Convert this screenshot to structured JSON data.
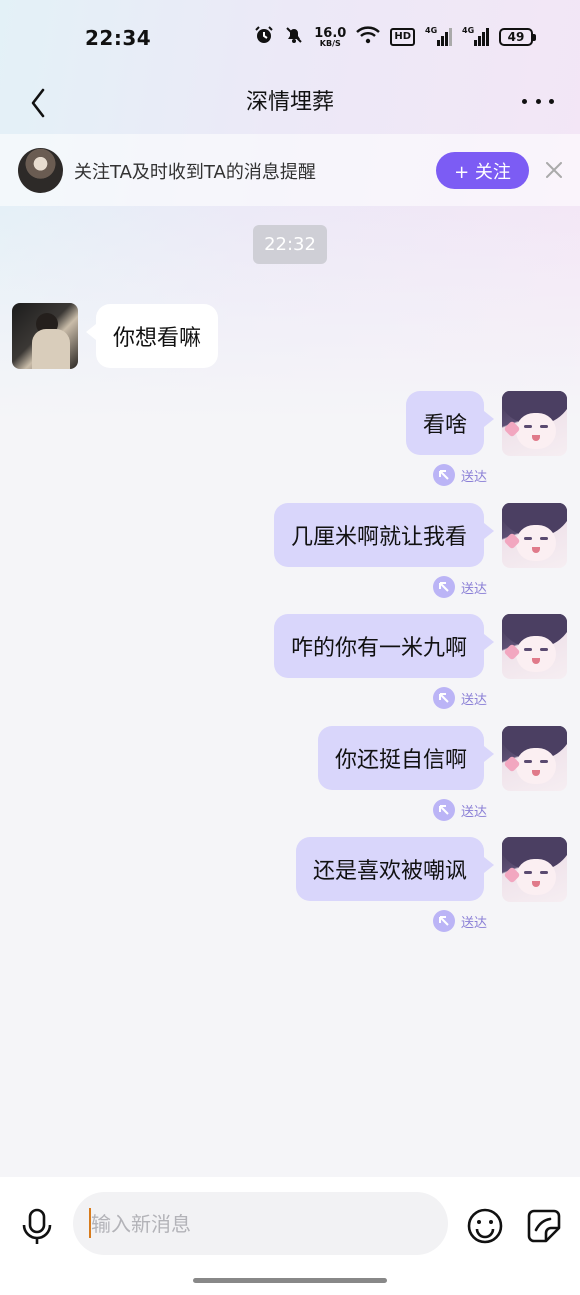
{
  "status_bar": {
    "time": "22:34",
    "net_speed": "16.0",
    "net_speed_unit": "KB/S",
    "hd_label": "HD",
    "signal1_label": "4G",
    "signal2_label": "4G",
    "battery": "49"
  },
  "header": {
    "title": "深情埋葬"
  },
  "follow_banner": {
    "text": "关注TA及时收到TA的消息提醒",
    "button_label": "+ 关注"
  },
  "chat": {
    "time_divider": "22:32",
    "incoming": [
      {
        "text": "你想看嘛"
      }
    ],
    "outgoing": [
      {
        "text": "看啥",
        "status": "送达"
      },
      {
        "text": "几厘米啊就让我看",
        "status": "送达"
      },
      {
        "text": "咋的你有一米九啊",
        "status": "送达"
      },
      {
        "text": "你还挺自信啊",
        "status": "送达"
      },
      {
        "text": "还是喜欢被嘲讽",
        "status": "送达"
      }
    ]
  },
  "input": {
    "placeholder": "输入新消息"
  },
  "colors": {
    "accent": "#7c5cf4",
    "outgoing_bubble": "#d9d6fb",
    "delivered_text": "#8a7fd6"
  }
}
